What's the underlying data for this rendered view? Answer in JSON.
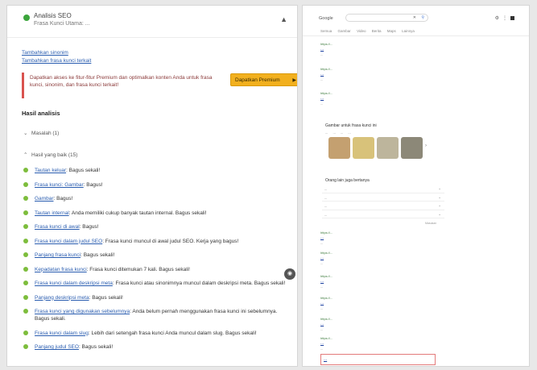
{
  "left": {
    "plugin_title": "Analisis SEO",
    "plugin_subtitle": "Frasa Kunci Utama: ...",
    "links": [
      "Tambahkan sinonim",
      "Tambahkan frasa kunci terkait"
    ],
    "alert_text": "Dapatkan akses ke fitur-fitur Premium dan optimalkan konten Anda untuk frasa kunci, sinonim, dan frasa kunci terkait!",
    "upgrade_label": "Dapatkan Premium",
    "results_heading": "Hasil analisis",
    "groups": [
      {
        "label": "Masalah (1)"
      },
      {
        "label": "Hasil yang baik (15)"
      }
    ],
    "items": [
      {
        "link": "Tautan keluar",
        "text": ": Bagus sekali!"
      },
      {
        "link": "Frasa kunci: Gambar",
        "text": ": Bagus!"
      },
      {
        "link": "Gambar",
        "text": ": Bagus!"
      },
      {
        "link": "Tautan internal",
        "text": ": Anda memiliki cukup banyak tautan internal. Bagus sekali!"
      },
      {
        "link": "Frasa kunci di awal",
        "text": ": Bagus!"
      },
      {
        "link": "Frasa kunci dalam judul SEO",
        "text": ": Frasa kunci muncul di awal judul SEO. Kerja yang bagus!"
      },
      {
        "link": "Panjang frasa kunci",
        "text": ": Bagus sekali!"
      },
      {
        "link": "Kepadatan frasa kunci",
        "text": ": Frasa kunci ditemukan 7 kali. Bagus sekali!"
      },
      {
        "link": "Frasa kunci dalam deskripsi meta",
        "text": ": Frasa kunci atau sinonimnya muncul dalam deskripsi meta. Bagus sekali!"
      },
      {
        "link": "Panjang deskripsi meta",
        "text": ": Bagus sekali!"
      },
      {
        "link": "Frasa kunci yang digunakan sebelumnya",
        "text": ": Anda belum pernah menggunakan frasa kunci ini sebelumnya. Bagus sekali."
      },
      {
        "link": "Frasa kunci dalam slug",
        "text": ": Lebih dari setengah frasa kunci Anda muncul dalam slug. Bagus sekali!"
      },
      {
        "link": "Panjang judul SEO",
        "text": ": Bagus sekali!"
      }
    ]
  },
  "right": {
    "logo_text": "Google",
    "search_query": "",
    "tabs": [
      "Semua",
      "Gambar",
      "Video",
      "Berita",
      "Maps",
      "Lainnya"
    ],
    "results_top": [
      {
        "url": "https://...",
        "title": "...",
        "desc": "..."
      },
      {
        "url": "https://...",
        "title": "...",
        "desc": "..."
      },
      {
        "url": "https://...",
        "title": "...",
        "desc": "..."
      }
    ],
    "images_heading": "Gambar untuk frasa kunci ini",
    "image_chips": [
      "...",
      "...",
      "...",
      "..."
    ],
    "paa_heading": "Orang lain juga bertanya",
    "paa_items": [
      "...",
      "...",
      "...",
      "..."
    ],
    "feedback": "Masukan",
    "results_bottom": [
      {
        "url": "https://...",
        "title": "...",
        "desc": "..."
      },
      {
        "url": "https://...",
        "title": "...",
        "desc": "..."
      },
      {
        "url": "https://...",
        "title": "...",
        "desc": "..."
      },
      {
        "url": "https://...",
        "title": "...",
        "desc": "..."
      },
      {
        "url": "https://...",
        "title": "...",
        "desc": "..."
      },
      {
        "url": "https://...",
        "title": "...",
        "desc": "..."
      }
    ],
    "highlighted_result": "..."
  }
}
